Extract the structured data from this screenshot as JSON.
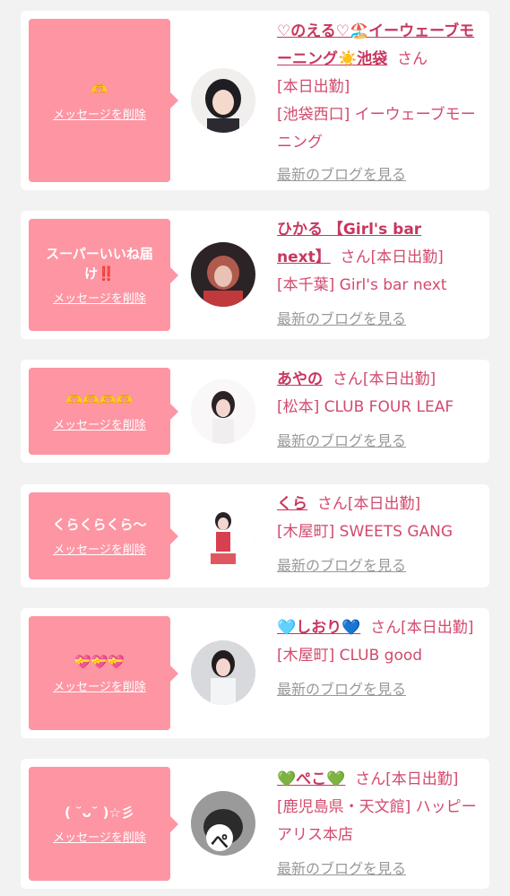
{
  "cards": [
    {
      "message": "🫶",
      "delete_label": "メッセージを削除",
      "name": "♡のえる♡🏖️イーウェーブモーニング☀️池袋",
      "san": "さん",
      "status": "[本日出勤]",
      "store": "[池袋西口] イーウェーブモーニング",
      "blog_label": "最新のブログを見る"
    },
    {
      "message": "スーパーいいね届け‼️",
      "delete_label": "メッセージを削除",
      "name": "ひかる 【Girl's bar next】",
      "san": "さん",
      "status": "[本日出勤]",
      "store": "[本千葉] Girl's bar next",
      "blog_label": "最新のブログを見る"
    },
    {
      "message": "🫶🫶🫶🫶",
      "delete_label": "メッセージを削除",
      "name": "あやの",
      "san": "さん",
      "status": "[本日出勤]",
      "store": "[松本] CLUB FOUR LEAF",
      "blog_label": "最新のブログを見る"
    },
    {
      "message": "くらくらくら〜",
      "delete_label": "メッセージを削除",
      "name": "くら",
      "san": "さん",
      "status": "[本日出勤]",
      "store": "[木屋町] SWEETS GANG",
      "blog_label": "最新のブログを見る"
    },
    {
      "message": "💝💝💝",
      "delete_label": "メッセージを削除",
      "name": "🩵しおり💙",
      "san": "さん",
      "status": "[本日出勤]",
      "store": "[木屋町] CLUB good",
      "blog_label": "最新のブログを見る"
    },
    {
      "message": "( ˘ᴗ˘ )☆彡",
      "delete_label": "メッセージを削除",
      "name": "💚ぺこ💚",
      "san": "さん",
      "status": "[本日出勤]",
      "store": "[鹿児島県・天文館] ハッピーアリス本店",
      "blog_label": "最新のブログを見る"
    }
  ],
  "avatar_glyph_6": "ぺ"
}
